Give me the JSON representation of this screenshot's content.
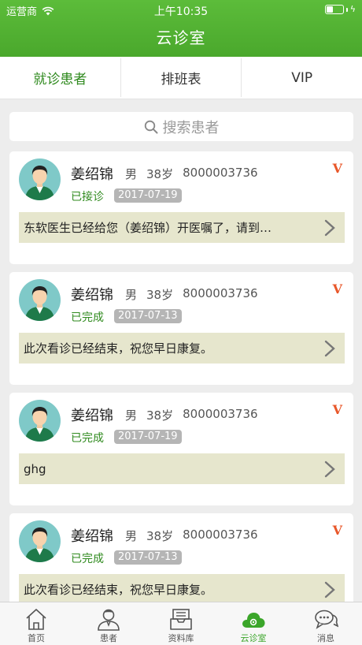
{
  "status_bar": {
    "carrier": "运营商",
    "time": "上午10:35"
  },
  "nav": {
    "title": "云诊室"
  },
  "tabs": [
    {
      "label": "就诊患者",
      "active": true
    },
    {
      "label": "排班表",
      "active": false
    },
    {
      "label": "VIP",
      "active": false
    }
  ],
  "search": {
    "placeholder": "搜索患者"
  },
  "patients": [
    {
      "name": "姜绍锦",
      "gender": "男",
      "age": "38岁",
      "id": "8000003736",
      "status": "已接诊",
      "date": "2017-07-19",
      "message": "东软医生已经给您（姜绍锦）开医嘱了，请到…",
      "vip": "V"
    },
    {
      "name": "姜绍锦",
      "gender": "男",
      "age": "38岁",
      "id": "8000003736",
      "status": "已完成",
      "date": "2017-07-13",
      "message": "此次看诊已经结束，祝您早日康复。",
      "vip": "V"
    },
    {
      "name": "姜绍锦",
      "gender": "男",
      "age": "38岁",
      "id": "8000003736",
      "status": "已完成",
      "date": "2017-07-19",
      "message": "ghg",
      "vip": "V"
    },
    {
      "name": "姜绍锦",
      "gender": "男",
      "age": "38岁",
      "id": "8000003736",
      "status": "已完成",
      "date": "2017-07-13",
      "message": "此次看诊已经结束，祝您早日康复。",
      "vip": "V"
    }
  ],
  "bottom_nav": [
    {
      "label": "首页",
      "icon": "home-icon",
      "active": false
    },
    {
      "label": "患者",
      "icon": "patient-icon",
      "active": false
    },
    {
      "label": "资料库",
      "icon": "archive-icon",
      "active": false
    },
    {
      "label": "云诊室",
      "icon": "cloud-clinic-icon",
      "active": true
    },
    {
      "label": "消息",
      "icon": "message-icon",
      "active": false
    }
  ],
  "colors": {
    "brand_green": "#4aa82c",
    "status_green": "#2f8a1e",
    "vip_orange": "#e8572a",
    "message_bg": "#e6e6cd"
  }
}
